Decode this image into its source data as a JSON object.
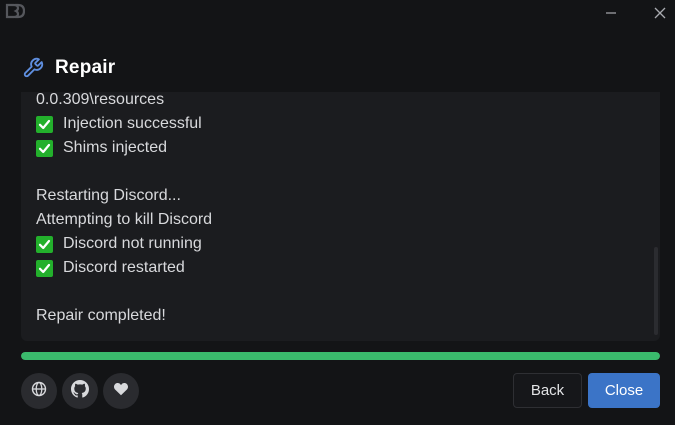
{
  "window": {
    "minimize_glyph": "—",
    "close_glyph": "✕"
  },
  "header": {
    "icon": "wrench-icon",
    "title": "Repair"
  },
  "log": {
    "lines": [
      {
        "text": "0.0.309\\resources",
        "check": false
      },
      {
        "text": "Injection successful",
        "check": true
      },
      {
        "text": "Shims injected",
        "check": true
      },
      {
        "text": "",
        "check": false
      },
      {
        "text": "Restarting Discord...",
        "check": false
      },
      {
        "text": "Attempting to kill Discord",
        "check": false
      },
      {
        "text": "Discord not running",
        "check": true
      },
      {
        "text": "Discord restarted",
        "check": true
      },
      {
        "text": "",
        "check": false
      },
      {
        "text": "Repair completed!",
        "check": false
      }
    ]
  },
  "progress": {
    "percent": 100,
    "color": "#3aba6c"
  },
  "footer": {
    "links": [
      {
        "icon": "globe-icon"
      },
      {
        "icon": "github-icon"
      },
      {
        "icon": "heart-icon"
      }
    ],
    "back_label": "Back",
    "close_label": "Close"
  },
  "colors": {
    "accent": "#3b74c7",
    "check": "#23b02c",
    "background": "#131416",
    "panel": "#1b1c1f"
  }
}
